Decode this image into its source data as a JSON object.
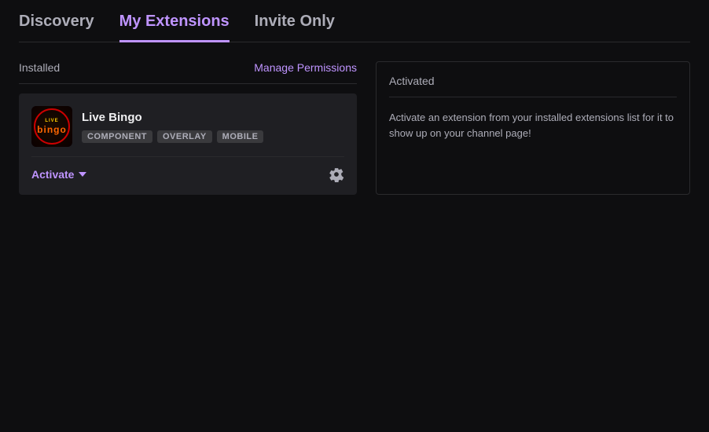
{
  "nav": {
    "tabs": [
      {
        "id": "discovery",
        "label": "Discovery",
        "active": false
      },
      {
        "id": "my-extensions",
        "label": "My Extensions",
        "active": true
      },
      {
        "id": "invite-only",
        "label": "Invite Only",
        "active": false
      }
    ]
  },
  "installed_panel": {
    "label": "Installed",
    "manage_permissions_label": "Manage Permissions"
  },
  "extension_card": {
    "name": "Live Bingo",
    "tags": [
      "COMPONENT",
      "OVERLAY",
      "MOBILE"
    ],
    "activate_label": "Activate",
    "settings_label": "Settings"
  },
  "activated_panel": {
    "header": "Activated",
    "description": "Activate an extension from your installed extensions list for it to show up on your channel page!"
  },
  "colors": {
    "accent": "#bf94ff",
    "background": "#0e0e10",
    "card_bg": "#1f1f23",
    "muted": "#adadb8"
  }
}
